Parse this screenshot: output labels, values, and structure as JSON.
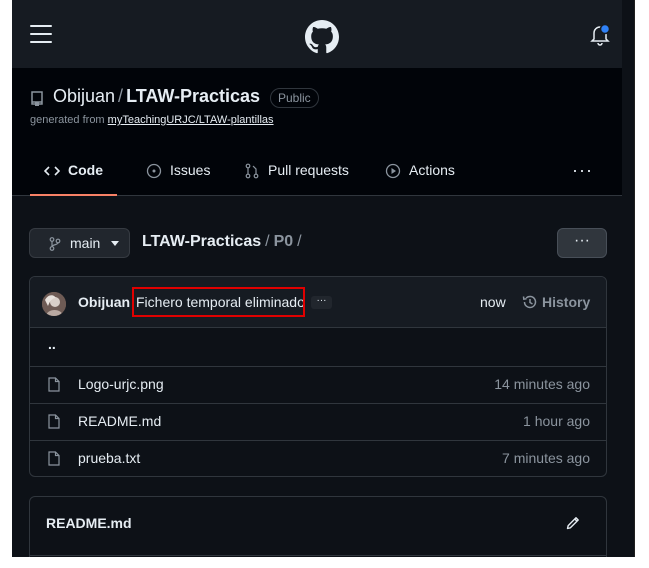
{
  "repo": {
    "owner": "Obijuan",
    "separator": "/",
    "name": "LTAW-Practicas",
    "visibility": "Public",
    "generated_prefix": "generated from",
    "template_link": "myTeachingURJC/LTAW-plantillas"
  },
  "tabs": [
    {
      "label": "Code",
      "icon": "code-icon",
      "active": true
    },
    {
      "label": "Issues",
      "icon": "issue-icon"
    },
    {
      "label": "Pull requests",
      "icon": "pull-request-icon"
    },
    {
      "label": "Actions",
      "icon": "play-icon"
    }
  ],
  "tabs_more": "···",
  "branch": {
    "label": "main"
  },
  "breadcrumb": {
    "repo": "LTAW-Practicas",
    "sep1": "/",
    "dir": "P0",
    "sep2": "/"
  },
  "more_button": "···",
  "commit": {
    "author": "Obijuan",
    "message": "Fichero temporal eliminado",
    "ellipsis": "···",
    "time": "now",
    "history_label": "History"
  },
  "parent_dir": "..",
  "files": [
    {
      "name": "Logo-urjc.png",
      "date": "14 minutes ago"
    },
    {
      "name": "README.md",
      "date": "1 hour ago"
    },
    {
      "name": "prueba.txt",
      "date": "7 minutes ago"
    }
  ],
  "readme": {
    "title": "README.md"
  },
  "colors": {
    "background": "#0d1117",
    "header": "#161b22",
    "accent_tab": "#f78166",
    "notification_dot": "#2f81f7",
    "highlight_box": "#e00000"
  }
}
